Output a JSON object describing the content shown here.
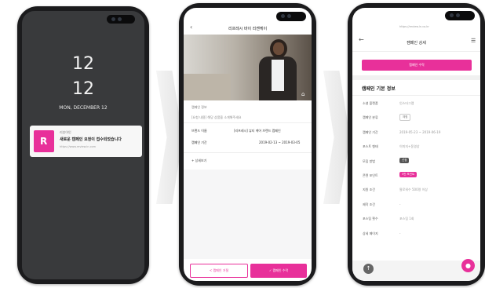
{
  "phone1": {
    "time_hour": "12",
    "time_min": "12",
    "date": "MON, DECEMBER 12",
    "notification": {
      "app_icon_letter": "R",
      "app_name": "리뷰아인",
      "message": "새로운 캠페인 요청이 접수되었습니다",
      "detail": "https://www.review.in.com"
    }
  },
  "phone2": {
    "header_title": "리프레시 바이 리쎈케이",
    "section_label": "캠페인 정보",
    "sub_text": "[요청 내용] 해당 상품을 소개해주세요",
    "rows": [
      {
        "label": "브랜드 이름",
        "value": "[리프레시] 뷰티 케어 브랜드 캠페인"
      },
      {
        "label": "캠페인 기간",
        "value": "2019-02-13 ~ 2019-03-05"
      }
    ],
    "more_label": "+ 상세보기",
    "btn_left": "< 캠페인 거절",
    "btn_right": "✓ 캠페인 수락"
  },
  "phone3": {
    "url": "https://review.in.co.kr",
    "header_title": "캠페인 상세",
    "banner_btn": "캠페인 수락",
    "section_title": "캠페인 기본 정보",
    "rows": [
      {
        "label": "소셜 플랫폼",
        "value": "인스타그램"
      },
      {
        "label": "캠페인 분류",
        "value": "체험"
      },
      {
        "label": "캠페인 기간",
        "value": "2019-05-23 ~ 2019-06-19"
      },
      {
        "label": "포스트 형태",
        "value": "이미지+동영상"
      },
      {
        "label": "모집 방법",
        "value": "선정"
      },
      {
        "label": "콘텐 포인트",
        "value": "5만 포인트"
      },
      {
        "label": "지원 조건",
        "value": "팔로워수 500명 이상"
      },
      {
        "label": "제작 조건",
        "value": "-"
      },
      {
        "label": "포스팅 횟수",
        "value": "포스팅 1회"
      },
      {
        "label": "상세 페이지",
        "value": "-"
      }
    ],
    "accent": "#e8309a"
  },
  "colors": {
    "accent": "#e8309a",
    "phone_body": "#1b1b1d",
    "lockscreen": "#393a3c"
  }
}
